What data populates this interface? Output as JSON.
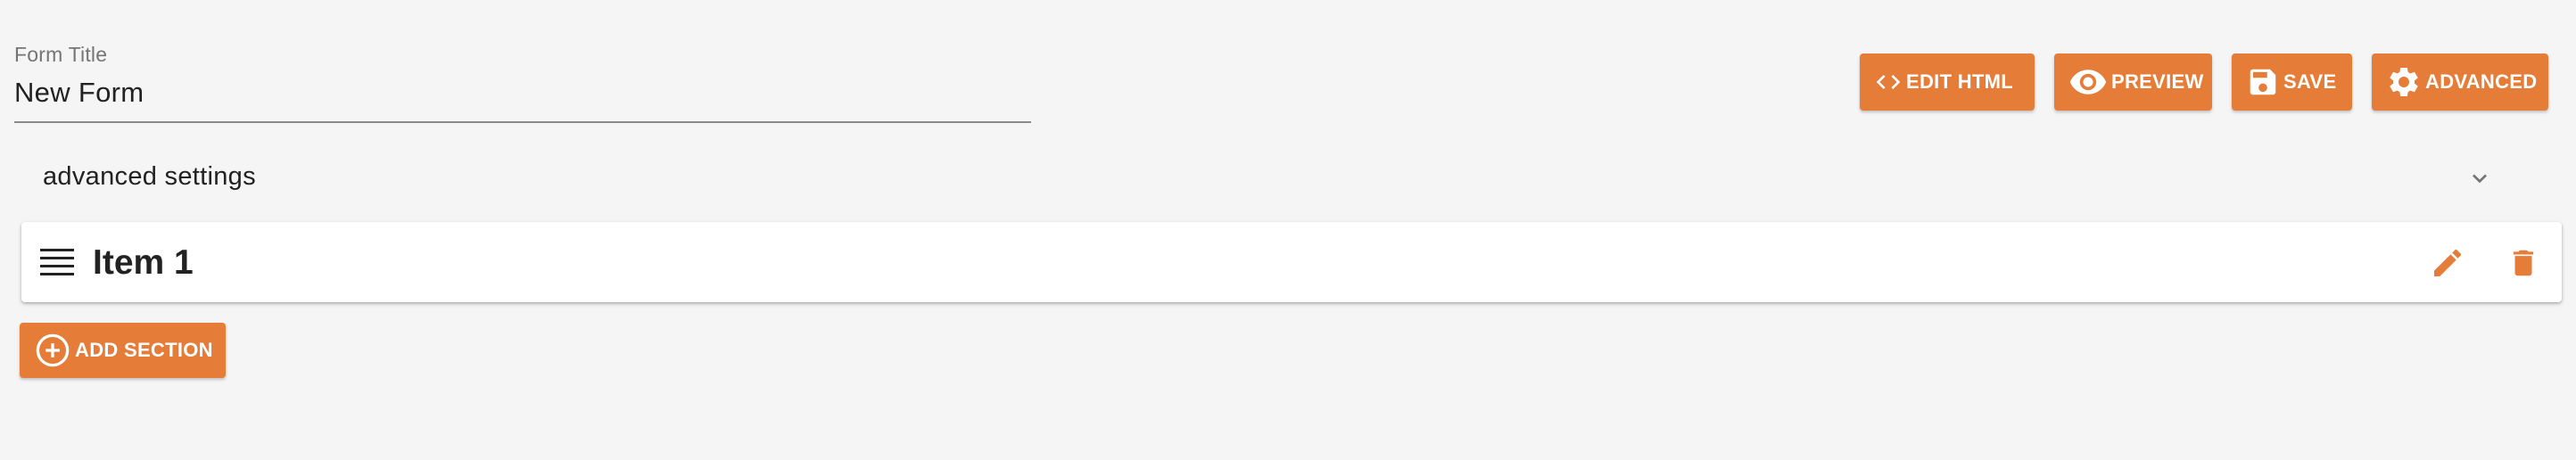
{
  "form": {
    "title_label": "Form Title",
    "title_value": "New Form"
  },
  "toolbar": {
    "edit_html_label": "EDIT HTML",
    "preview_label": "PREVIEW",
    "save_label": "SAVE",
    "advanced_label": "ADVANCED"
  },
  "advanced_settings": {
    "label": "advanced settings",
    "icon": "chevron-down-icon"
  },
  "sections": [
    {
      "title": "Item 1",
      "icons": [
        "drag-handle-icon",
        "pencil-icon",
        "trash-icon"
      ]
    }
  ],
  "add_section": {
    "label": "ADD SECTION",
    "icon": "add-circle-icon"
  },
  "colors": {
    "accent": "#e57c37",
    "background": "#f5f5f5",
    "card": "#ffffff",
    "text": "#212121"
  }
}
